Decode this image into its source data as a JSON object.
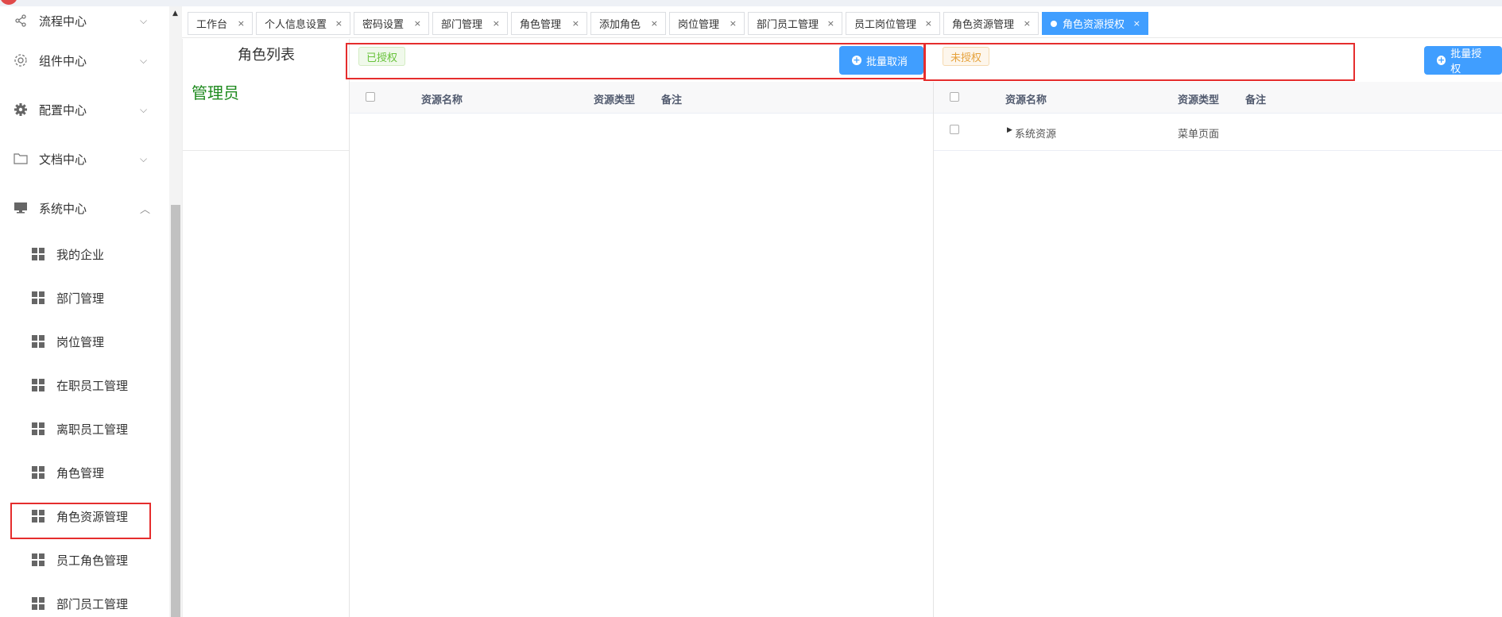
{
  "sidebar": {
    "groups": [
      {
        "label": "流程中心",
        "icon": "share-icon",
        "chevron": "v"
      },
      {
        "label": "组件中心",
        "icon": "gear-outline-icon",
        "chevron": "v"
      },
      {
        "label": "配置中心",
        "icon": "gear-icon",
        "chevron": "v"
      },
      {
        "label": "文档中心",
        "icon": "folder-icon",
        "chevron": "v"
      },
      {
        "label": "系统中心",
        "icon": "monitor-icon",
        "chevron": "^"
      }
    ],
    "items": [
      {
        "label": "我的企业"
      },
      {
        "label": "部门管理"
      },
      {
        "label": "岗位管理"
      },
      {
        "label": "在职员工管理"
      },
      {
        "label": "离职员工管理"
      },
      {
        "label": "角色管理"
      },
      {
        "label": "角色资源管理"
      },
      {
        "label": "员工角色管理"
      },
      {
        "label": "部门员工管理"
      }
    ]
  },
  "tabs": [
    {
      "label": "工作台"
    },
    {
      "label": "个人信息设置"
    },
    {
      "label": "密码设置"
    },
    {
      "label": "部门管理"
    },
    {
      "label": "角色管理"
    },
    {
      "label": "添加角色"
    },
    {
      "label": "岗位管理"
    },
    {
      "label": "部门员工管理"
    },
    {
      "label": "员工岗位管理"
    },
    {
      "label": "角色资源管理"
    },
    {
      "label": "角色资源授权"
    }
  ],
  "tab_close": "×",
  "role_panel": {
    "title": "角色列表",
    "roles": [
      "管理员"
    ]
  },
  "authorized": {
    "tag": "已授权",
    "button": "批量取消",
    "columns": [
      "资源名称",
      "资源类型",
      "备注"
    ]
  },
  "unauthorized": {
    "tag": "未授权",
    "button": "批量授权",
    "columns": [
      "资源名称",
      "资源类型",
      "备注"
    ],
    "rows": [
      {
        "name": "系统资源",
        "type": "菜单页面",
        "note": ""
      }
    ]
  },
  "colors": {
    "accent": "#409eff",
    "role_green": "#1e8a1e",
    "highlight_red": "#e52d2d"
  }
}
